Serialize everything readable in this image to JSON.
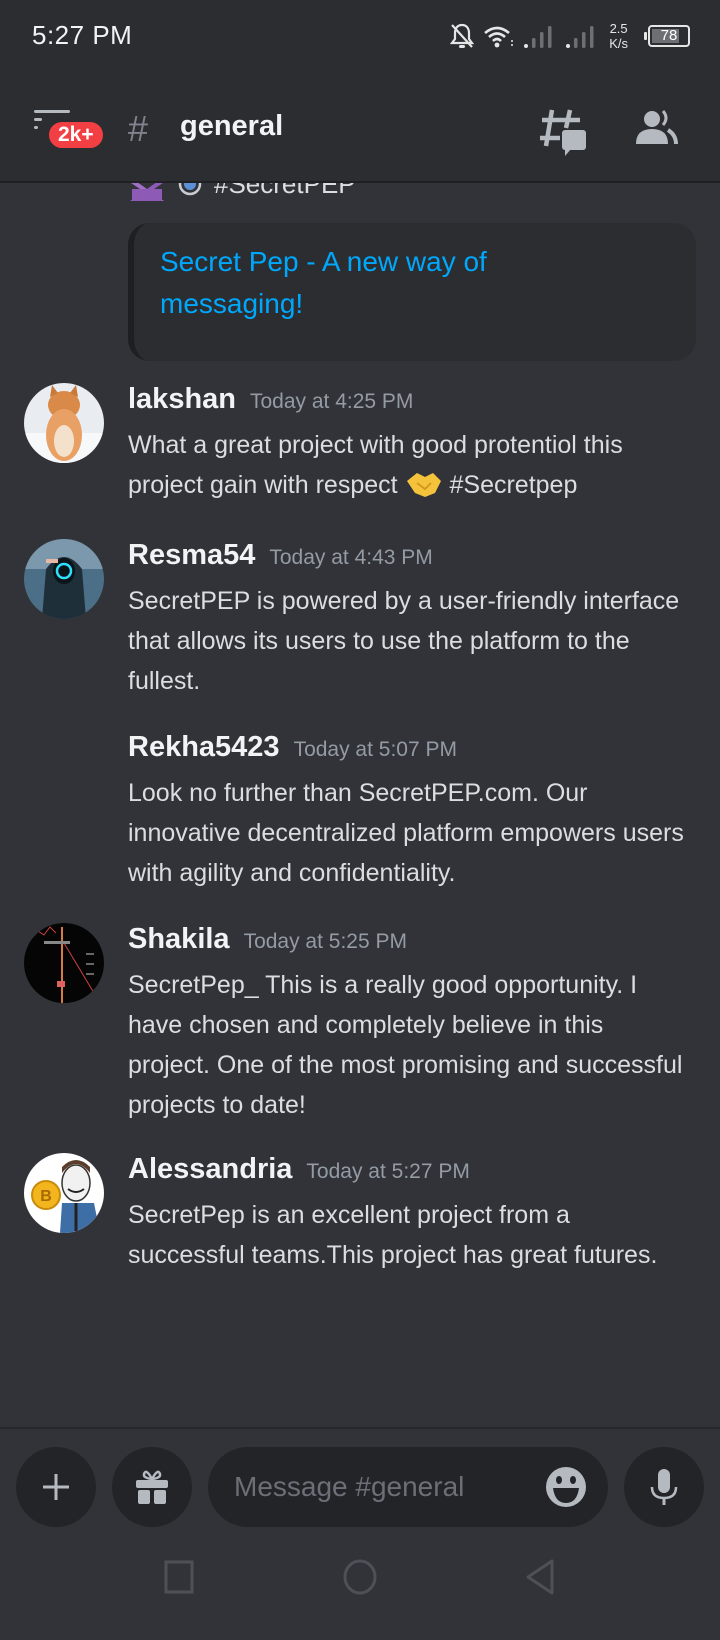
{
  "status_bar": {
    "time": "5:27 PM",
    "net_speed_value": "2.5",
    "net_speed_unit": "K/s",
    "battery_percent": 78,
    "battery_label": "78",
    "icons": [
      "bell-off-icon",
      "wifi-icon",
      "signal-icon",
      "signal-icon",
      "battery-icon"
    ]
  },
  "header": {
    "menu_icon": "menu-icon",
    "badge": "2k+",
    "hash_symbol": "#",
    "channel_name": "general",
    "threads_icon": "threads-icon",
    "members_icon": "members-icon"
  },
  "colors": {
    "background": "#313338",
    "header_bg": "#2b2d31",
    "badge": "#f23f43",
    "link": "#00a8fc",
    "timestamp": "#949ba4"
  },
  "embed": {
    "hashtag": "#SecretPEP",
    "title": "Secret Pep - A new way of messaging!"
  },
  "messages": [
    {
      "author": "lakshan",
      "timestamp": "Today at 4:25 PM",
      "text_before_emoji": "What a great project with good protentiol this project gain with respect",
      "emoji": "handshake",
      "text_after_emoji": " #Secretpep",
      "avatar": "cat"
    },
    {
      "author": "Resma54",
      "timestamp": "Today at 4:43 PM",
      "text": "SecretPEP is powered by a user-friendly interface that allows its users to use the platform to the fullest.",
      "avatar": "hooded-figure"
    },
    {
      "author": "Rekha5423",
      "timestamp": "Today at 5:07 PM",
      "text": "Look no further than SecretPEP.com. Our innovative decentralized platform empowers users with agility and confidentiality."
    },
    {
      "author": "Shakila",
      "timestamp": "Today at 5:25 PM",
      "text": "SecretPep_ This is a really good opportunity. I have chosen and completely believe in this project. One of the most promising and successful projects to date!",
      "avatar": "chart"
    },
    {
      "author": "Alessandria",
      "timestamp": "Today at 5:27 PM",
      "text": "SecretPep is an excellent project from a successful teams.This project has great futures.",
      "avatar": "bitcoin-man"
    }
  ],
  "composer": {
    "placeholder": "Message #general",
    "value": ""
  },
  "nav": {
    "recents": "recents-icon",
    "home": "home-icon",
    "back": "back-icon"
  }
}
